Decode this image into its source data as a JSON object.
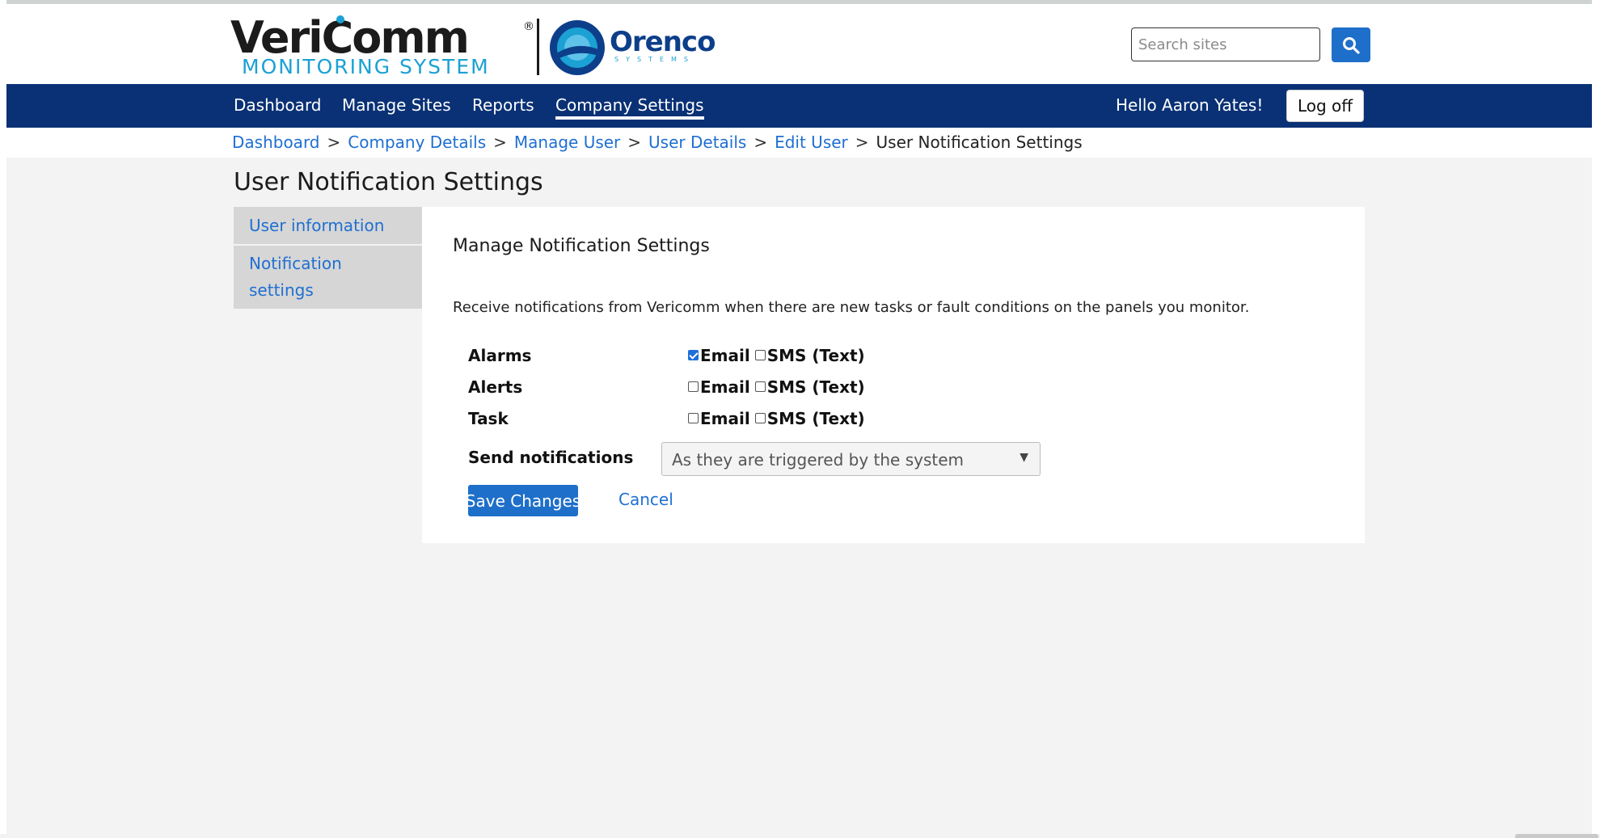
{
  "brand": {
    "logo_main": "VeriComm",
    "logo_sub": "MONITORING SYSTEM",
    "partner_logo": "Orenco",
    "partner_sub": "SYSTEMS",
    "colors": {
      "navy": "#0a3175",
      "accent": "#1e6fc9",
      "link": "#1f6fd1",
      "teal": "#1ba1d3"
    }
  },
  "search": {
    "placeholder": "Search sites",
    "icon": "search-icon"
  },
  "nav": {
    "items": [
      {
        "label": "Dashboard"
      },
      {
        "label": "Manage Sites"
      },
      {
        "label": "Reports"
      },
      {
        "label": "Company Settings",
        "active": true
      }
    ],
    "greeting": "Hello Aaron Yates!",
    "logoff_label": "Log off"
  },
  "breadcrumb": {
    "items": [
      "Dashboard",
      "Company Details",
      "Manage User",
      "User Details",
      "Edit User"
    ],
    "separator": ">",
    "current": "User Notification Settings"
  },
  "page": {
    "title": "User Notification Settings"
  },
  "sidebar": {
    "items": [
      {
        "label": "User information"
      },
      {
        "label": "Notification settings"
      }
    ]
  },
  "panel": {
    "title": "Manage Notification Settings",
    "description": "Receive notifications from Vericomm when there are new tasks or fault conditions on the panels you monitor.",
    "email_label": "Email",
    "sms_label": "SMS (Text)",
    "rows": [
      {
        "label": "Alarms",
        "email": true,
        "sms": false
      },
      {
        "label": "Alerts",
        "email": false,
        "sms": false
      },
      {
        "label": "Task",
        "email": false,
        "sms": false
      }
    ],
    "send_label": "Send notifications",
    "send_value": "As they are triggered by the system",
    "save_label": "Save Changes",
    "cancel_label": "Cancel"
  }
}
